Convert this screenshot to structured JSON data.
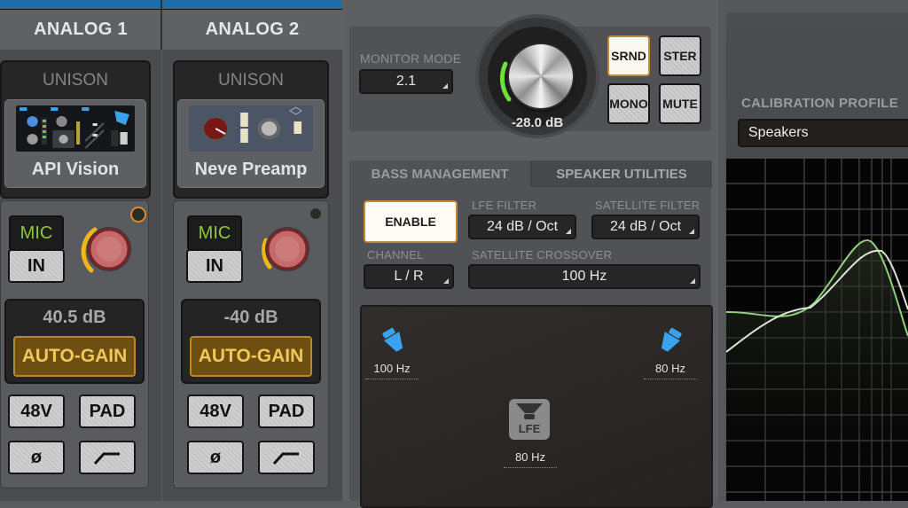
{
  "channels": [
    {
      "name": "ANALOG 1",
      "unison_label": "UNISON",
      "plugin": "API Vision",
      "input_type": "MIC",
      "input_button": "IN",
      "gain_value": "40.5 dB",
      "gain_knob_fraction": 0.55,
      "auto_gain_label": "AUTO-GAIN",
      "indicator_active": true,
      "buttons": {
        "phantom": "48V",
        "pad": "PAD",
        "phase": "ø",
        "lowcut": "low-cut-filter"
      }
    },
    {
      "name": "ANALOG 2",
      "unison_label": "UNISON",
      "plugin": "Neve Preamp",
      "input_type": "MIC",
      "input_button": "IN",
      "gain_value": "-40 dB",
      "gain_knob_fraction": 0.35,
      "auto_gain_label": "AUTO-GAIN",
      "indicator_active": false,
      "buttons": {
        "phantom": "48V",
        "pad": "PAD",
        "phase": "ø",
        "lowcut": "low-cut-filter"
      }
    }
  ],
  "monitor": {
    "mode_label": "MONITOR MODE",
    "mode_value": "2.1",
    "level": "-28.0 dB",
    "level_fraction": 0.3,
    "buttons": [
      {
        "label": "SRND",
        "active": true
      },
      {
        "label": "STER",
        "active": false
      },
      {
        "label": "MONO",
        "active": false
      },
      {
        "label": "MUTE",
        "active": false
      }
    ]
  },
  "bass_management": {
    "tabs": [
      {
        "label": "BASS MANAGEMENT",
        "active": true
      },
      {
        "label": "SPEAKER UTILITIES",
        "active": false
      }
    ],
    "enable_label": "ENABLE",
    "lfe_filter_label": "LFE FILTER",
    "lfe_filter_value": "24 dB / Oct",
    "satellite_filter_label": "SATELLITE FILTER",
    "satellite_filter_value": "24 dB / Oct",
    "channel_label": "CHANNEL",
    "channel_value": "L / R",
    "satellite_crossover_label": "SATELLITE CROSSOVER",
    "satellite_crossover_value": "100 Hz",
    "speakers": {
      "left": "100 Hz",
      "right": "80 Hz",
      "lfe_icon_label": "LFE",
      "lfe": "80 Hz"
    }
  },
  "calibration": {
    "label": "CALIBRATION PROFILE",
    "profile": "Speakers"
  },
  "colors": {
    "accent_blue": "#1f6ea8",
    "mic_green": "#8ec63f",
    "autogain_gold": "#f0c85a",
    "gain_arc": "#f2b51c",
    "monitor_arc": "#6ee03c",
    "speaker_blue": "#3aa3ee",
    "curve_green": "#8fcf7e",
    "curve_white": "#d9e3d2"
  }
}
